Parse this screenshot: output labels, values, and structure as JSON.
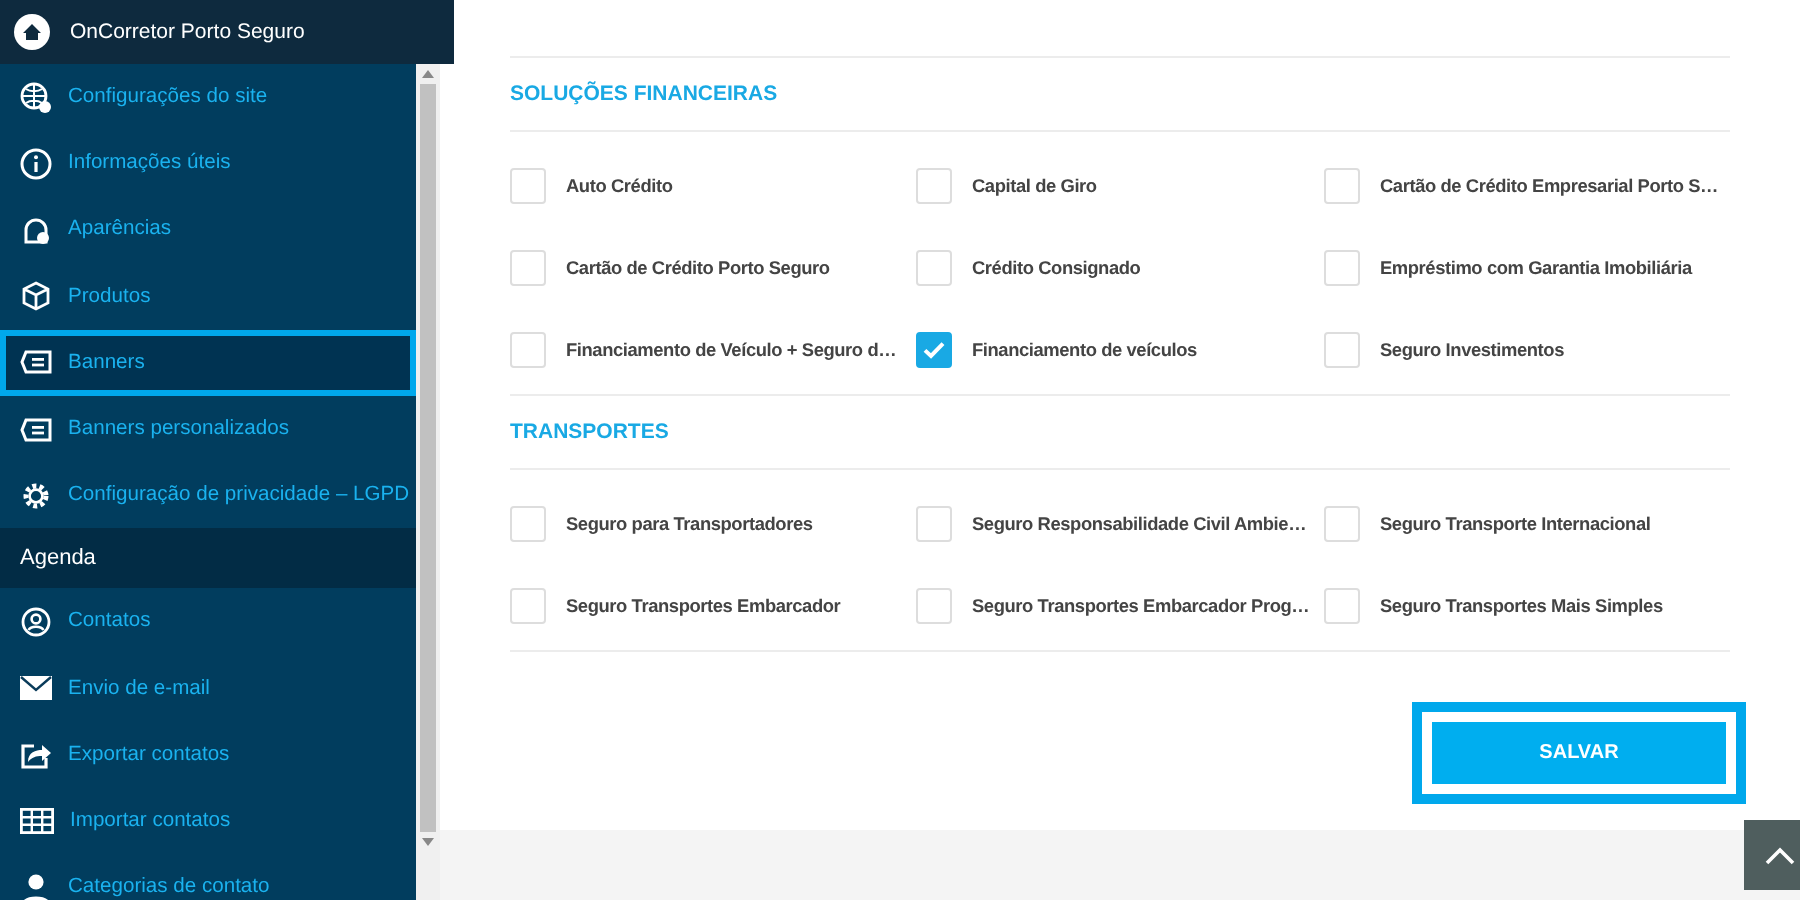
{
  "sidebar": {
    "title": "OnCorretor Porto Seguro",
    "items": [
      {
        "kind": "link",
        "label": "Configurações do site",
        "selected": false
      },
      {
        "kind": "link",
        "label": "Informações úteis",
        "selected": false
      },
      {
        "kind": "link",
        "label": "Aparências",
        "selected": false
      },
      {
        "kind": "link",
        "label": "Produtos",
        "selected": false
      },
      {
        "kind": "link",
        "label": "Banners",
        "selected": true
      },
      {
        "kind": "link",
        "label": "Banners personalizados",
        "selected": false
      },
      {
        "kind": "link",
        "label": "Configuração de privacidade – LGPD",
        "selected": false
      },
      {
        "kind": "section",
        "label": "Agenda"
      },
      {
        "kind": "link",
        "label": "Contatos",
        "selected": false
      },
      {
        "kind": "link",
        "label": "Envio de e-mail",
        "selected": false
      },
      {
        "kind": "link",
        "label": "Exportar contatos",
        "selected": false
      },
      {
        "kind": "link",
        "label": "Importar contatos",
        "selected": false
      },
      {
        "kind": "link",
        "label": "Categorias de contato",
        "selected": false
      }
    ]
  },
  "sections": [
    {
      "title": "SOLUÇÕES FINANCEIRAS",
      "options": [
        {
          "label": "Auto Crédito",
          "checked": false
        },
        {
          "label": "Capital de Giro",
          "checked": false
        },
        {
          "label": "Cartão de Crédito Empresarial Porto S…",
          "checked": false
        },
        {
          "label": "Cartão de Crédito Porto Seguro",
          "checked": false
        },
        {
          "label": "Crédito Consignado",
          "checked": false
        },
        {
          "label": "Empréstimo com Garantia Imobiliária",
          "checked": false
        },
        {
          "label": "Financiamento de Veículo + Seguro d…",
          "checked": false
        },
        {
          "label": "Financiamento de veículos",
          "checked": true
        },
        {
          "label": "Seguro Investimentos",
          "checked": false
        }
      ]
    },
    {
      "title": "TRANSPORTES",
      "options": [
        {
          "label": "Seguro para Transportadores",
          "checked": false
        },
        {
          "label": "Seguro Responsabilidade Civil Ambie…",
          "checked": false
        },
        {
          "label": "Seguro Transporte Internacional",
          "checked": false
        },
        {
          "label": "Seguro Transportes Embarcador",
          "checked": false
        },
        {
          "label": "Seguro Transportes Embarcador Prog…",
          "checked": false
        },
        {
          "label": "Seguro Transportes Mais Simples",
          "checked": false
        }
      ]
    }
  ],
  "save_button": "SALVAR"
}
